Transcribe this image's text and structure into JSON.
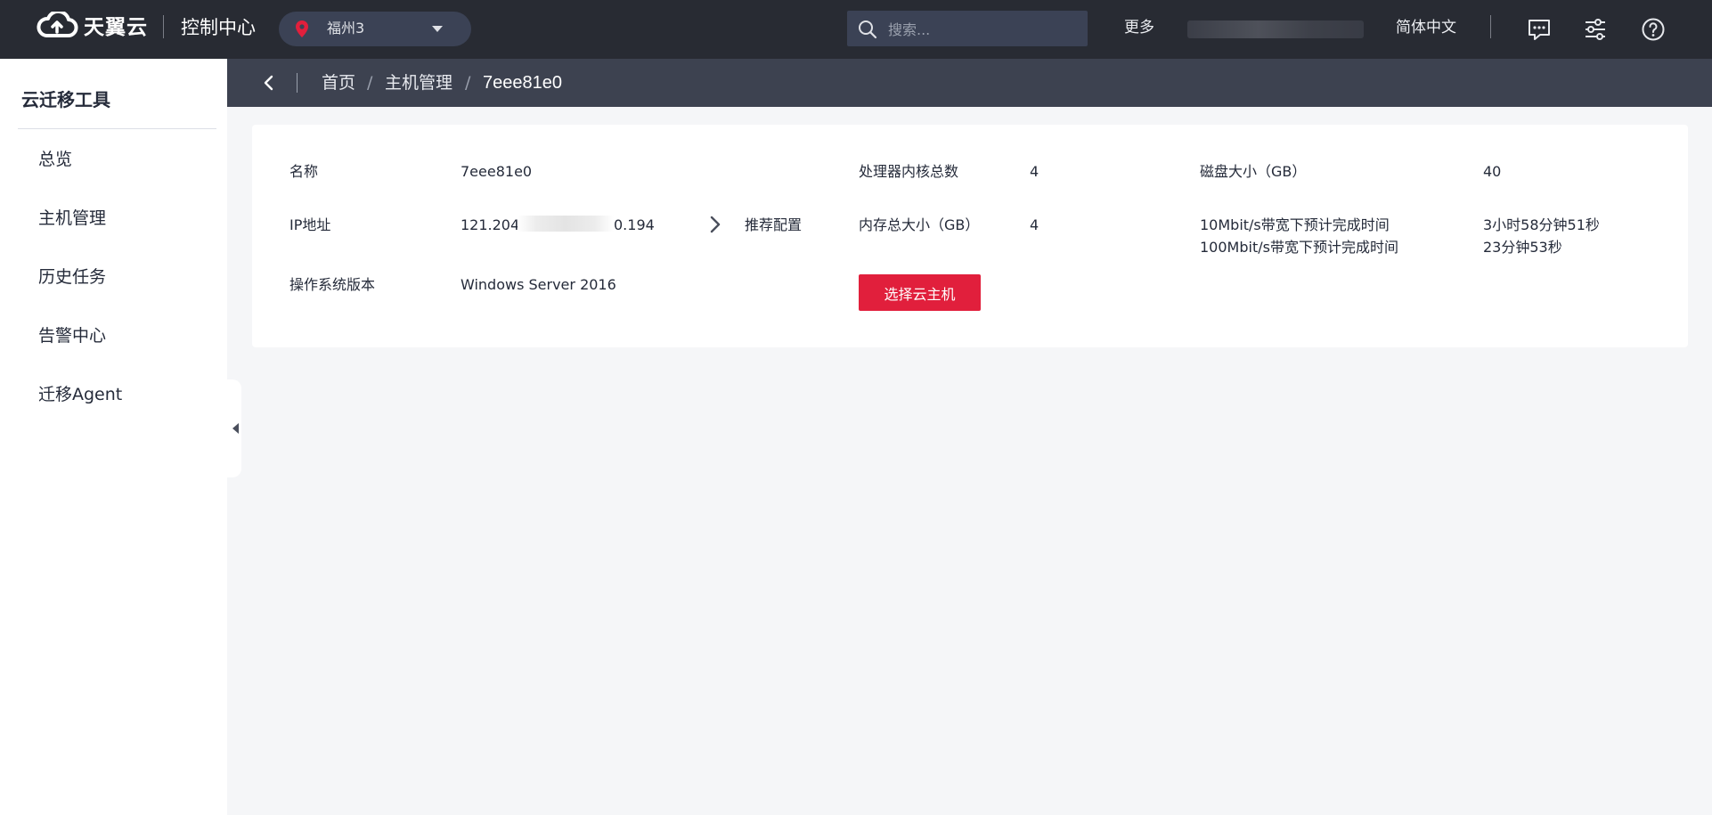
{
  "header": {
    "brand": "天翼云",
    "console_title": "控制中心",
    "region": "福州3",
    "search_placeholder": "搜索...",
    "more": "更多",
    "language": "简体中文",
    "icons": [
      "message-icon",
      "settings-sliders-icon",
      "help-icon"
    ]
  },
  "sidebar": {
    "title": "云迁移工具",
    "items": [
      {
        "label": "总览"
      },
      {
        "label": "主机管理"
      },
      {
        "label": "历史任务"
      },
      {
        "label": "告警中心"
      },
      {
        "label": "迁移Agent"
      }
    ]
  },
  "breadcrumb": {
    "home": "首页",
    "host_management": "主机管理",
    "current": "7eee81e0",
    "separator": "/"
  },
  "details": {
    "name_label": "名称",
    "name_value": "7eee81e0",
    "ip_label": "IP地址",
    "ip_prefix": "121.204",
    "ip_suffix": "0.194",
    "os_label": "操作系统版本",
    "os_value": "Windows Server 2016",
    "recommend_label": "推荐配置",
    "cpu_label": "处理器内核总数",
    "cpu_value": "4",
    "memory_label": "内存总大小（GB）",
    "memory_value": "4",
    "select_button": "选择云主机",
    "disk_label": "磁盘大小（GB）",
    "disk_value": "40",
    "eta_10m_label": "10Mbit/s带宽下预计完成时间",
    "eta_10m_value": "3小时58分钟51秒",
    "eta_100m_label": "100Mbit/s带宽下预计完成时间",
    "eta_100m_value": "23分钟53秒"
  },
  "colors": {
    "topbar": "#282b33",
    "breadcrumb_bar": "#3d4250",
    "primary": "#e11f3c",
    "region_pin": "#e11f3c"
  }
}
